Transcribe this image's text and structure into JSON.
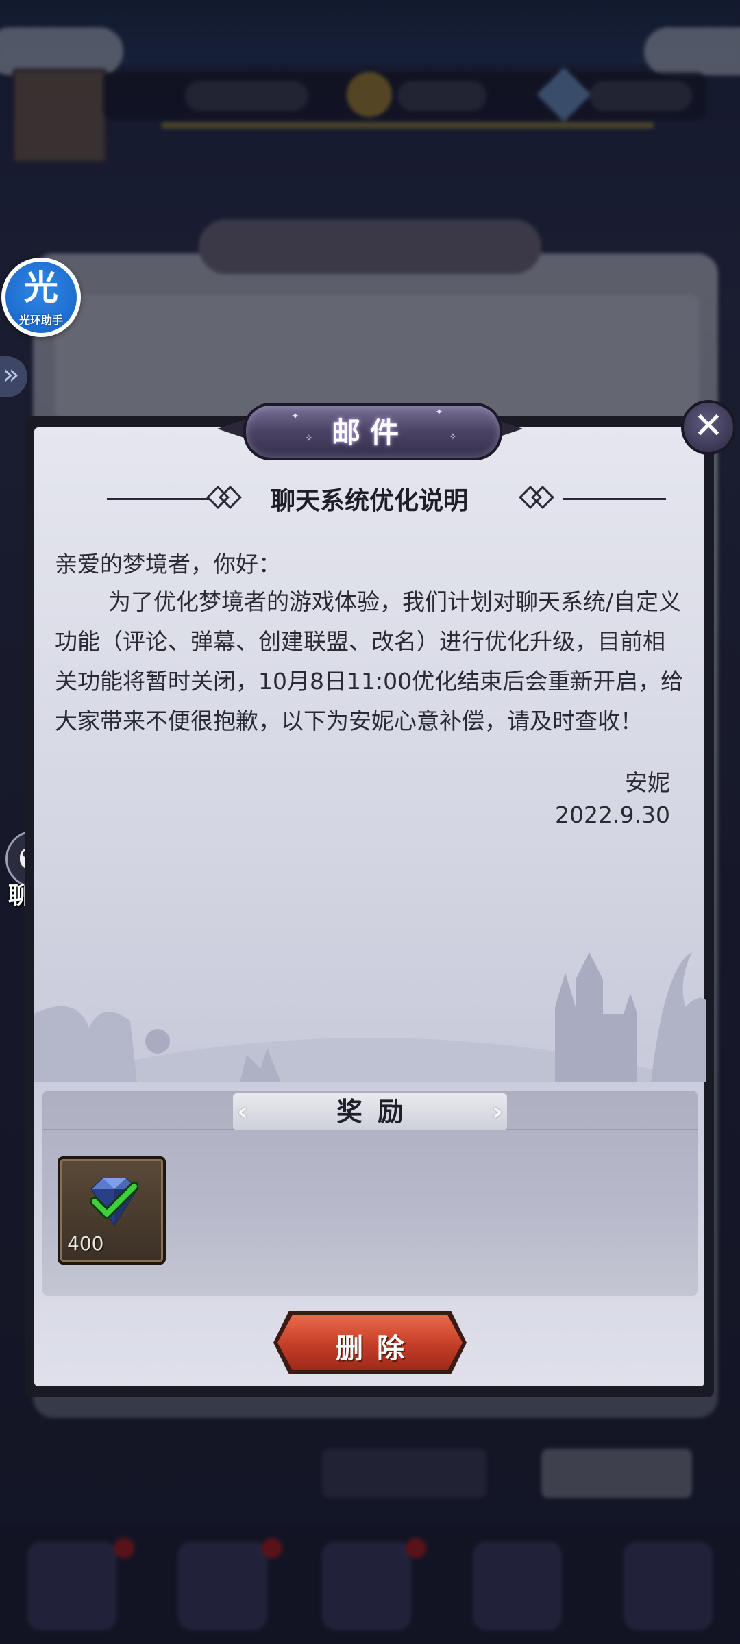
{
  "assistant_widget": {
    "glyph": "光",
    "label": "光环助手"
  },
  "chat_widget": {
    "label": "聊天"
  },
  "mail_modal": {
    "title": "邮件",
    "close_icon": "close-icon",
    "subject": "聊天系统优化说明",
    "greeting": "亲爱的梦境者，你好：",
    "body": "为了优化梦境者的游戏体验，我们计划对聊天系统/自定义功能（评论、弹幕、创建联盟、改名）进行优化升级，目前相关功能将暂时关闭，10月8日11:00优化结束后会重新开启，给大家带来不便很抱歉，以下为安妮心意补偿，请及时查收！",
    "signature": "安妮",
    "date": "2022.9.30",
    "rewards": {
      "header": "奖励",
      "items": [
        {
          "icon": "diamond-gem-icon",
          "quantity": "400",
          "claimed": true
        }
      ]
    },
    "delete_label": "删除"
  }
}
